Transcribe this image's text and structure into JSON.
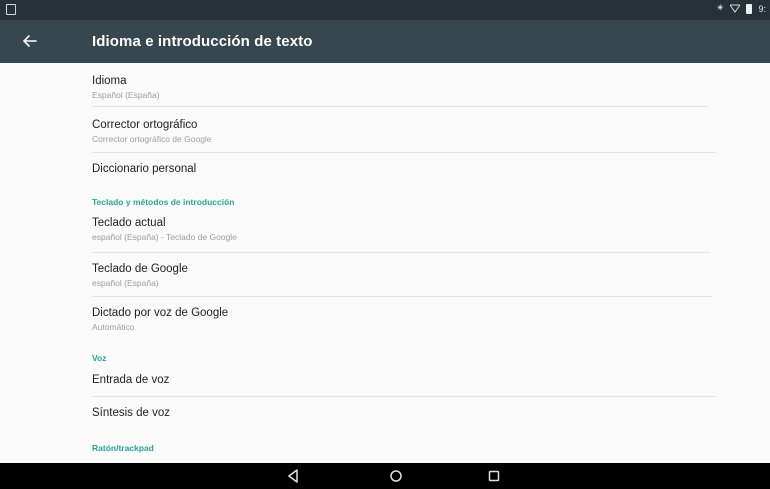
{
  "status_bar": {
    "time": "9:",
    "icons": [
      "notification-icon",
      "bluetooth-icon",
      "wifi-icon",
      "battery-icon"
    ]
  },
  "app_bar": {
    "title": "Idioma e introducción de texto",
    "back_icon": "arrow-back-icon"
  },
  "items": [
    {
      "title": "Idioma",
      "subtitle": "Español (España)"
    },
    {
      "title": "Corrector ortográfico",
      "subtitle": "Corrector ortográfico de Google"
    },
    {
      "title": "Diccionario personal"
    }
  ],
  "sections": {
    "keyboard": "Teclado y métodos de introducción",
    "voice": "Voz",
    "mouse": "Ratón/trackpad"
  },
  "keyboard_items": [
    {
      "title": "Teclado actual",
      "subtitle": "español (España) - Teclado de Google"
    },
    {
      "title": "Teclado de Google",
      "subtitle": "español (España)"
    },
    {
      "title": "Dictado por voz de Google",
      "subtitle": "Automático"
    }
  ],
  "voice_items": [
    {
      "title": "Entrada de voz"
    },
    {
      "title": "Síntesis de voz"
    }
  ],
  "colors": {
    "status_bar": "#263238",
    "app_bar": "#37474f",
    "accent": "#26a69a",
    "background": "#fafafa",
    "nav_bar": "#000000"
  },
  "nav_bar": {
    "buttons": [
      "back-triangle-icon",
      "home-circle-icon",
      "recents-square-icon"
    ]
  }
}
